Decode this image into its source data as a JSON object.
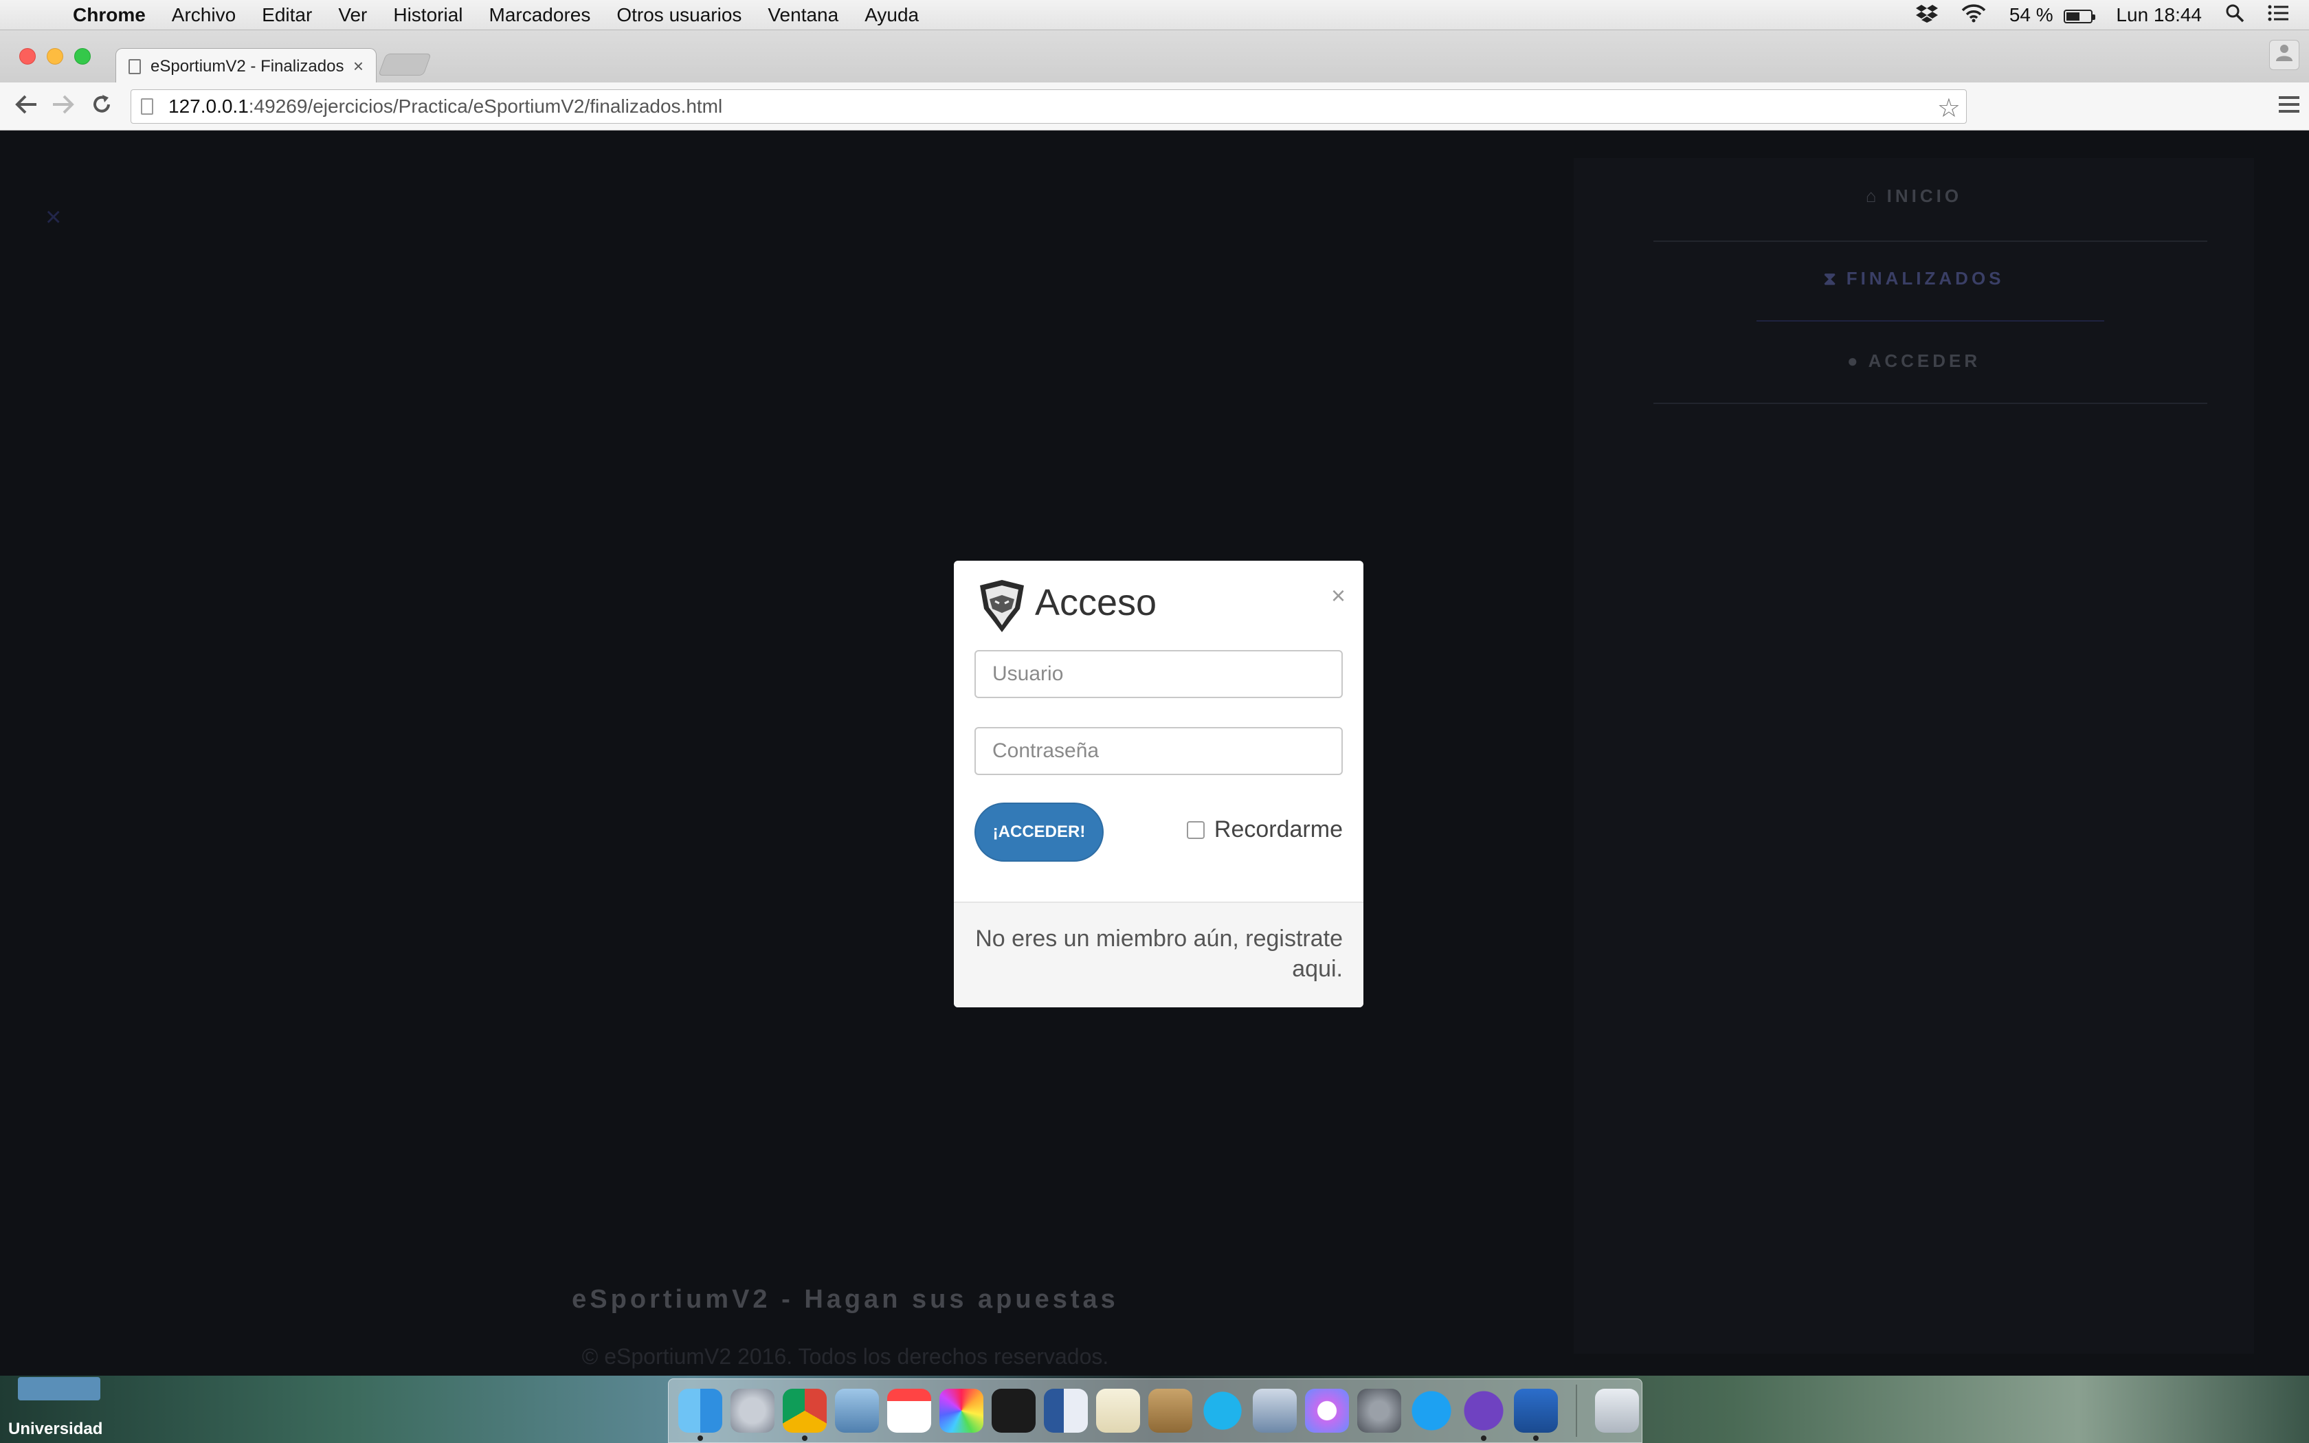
{
  "menubar": {
    "app_name": "Chrome",
    "menus": [
      "Archivo",
      "Editar",
      "Ver",
      "Historial",
      "Marcadores",
      "Otros usuarios",
      "Ventana",
      "Ayuda"
    ],
    "battery_percent": "54 %",
    "battery_level": 0.54,
    "clock": "Lun 18:44"
  },
  "browser": {
    "tab_title": "eSportiumV2 - Finalizados",
    "url_host": "127.0.0.1",
    "url_rest": ":49269/ejercicios/Practica/eSportiumV2/finalizados.html"
  },
  "page": {
    "nav": [
      {
        "label": "INICIO",
        "icon": "home-icon",
        "active": false
      },
      {
        "label": "FINALIZADOS",
        "icon": "hourglass-icon",
        "active": true
      },
      {
        "label": "ACCEDER",
        "icon": "user-icon",
        "active": false
      }
    ],
    "footer_title": "eSportiumV2 - Hagan sus apuestas",
    "footer_copy": "© eSportiumV2 2016. Todos los derechos reservados."
  },
  "modal": {
    "title": "Acceso",
    "username_placeholder": "Usuario",
    "password_placeholder": "Contraseña",
    "submit_label": "¡ACCEDER!",
    "remember_label": "Recordarme",
    "footer_text": "No eres un miembro aún, registrate aqui."
  },
  "desktop": {
    "folder_label": "Universidad",
    "dock_apps": [
      "finder",
      "launchpad",
      "chrome",
      "preview",
      "calendar",
      "photos",
      "terminal",
      "word",
      "textedit",
      "archive-utility",
      "skype",
      "remote-desktop",
      "itunes",
      "system-preferences",
      "twitter",
      "github-desktop",
      "sourcetree",
      "trash"
    ]
  },
  "colors": {
    "accent_blue": "#337ab7",
    "page_bg": "#0f1115",
    "nav_active": "#3a3f66"
  }
}
